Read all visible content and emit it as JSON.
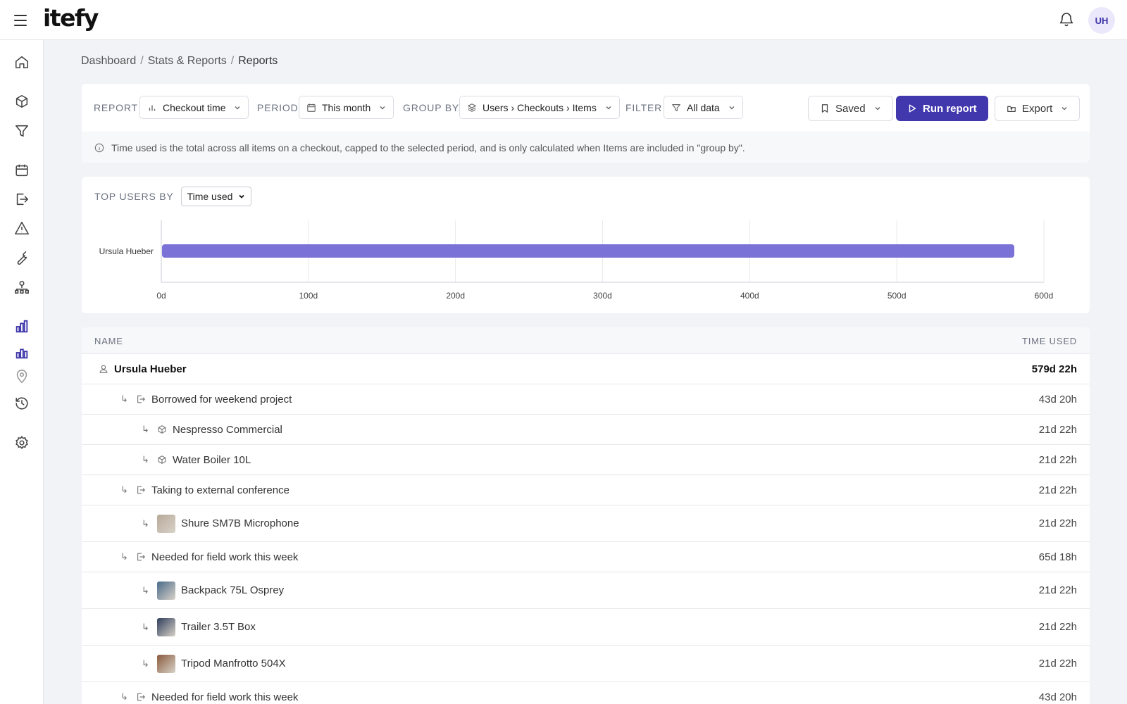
{
  "app": {
    "logo": "itefy",
    "user_initials": "UH"
  },
  "sidebar": {
    "items": [
      {
        "icon": "home-icon"
      },
      {
        "icon": "box-icon"
      },
      {
        "icon": "filter-icon"
      },
      {
        "icon": "calendar-icon"
      },
      {
        "icon": "checkout-icon"
      },
      {
        "icon": "alert-icon"
      },
      {
        "icon": "wrench-icon"
      },
      {
        "icon": "org-chart-icon"
      },
      {
        "icon": "bar-chart-icon"
      },
      {
        "icon": "bar-chart-alt-icon"
      },
      {
        "icon": "location-pin-icon"
      },
      {
        "icon": "history-icon"
      },
      {
        "icon": "gear-icon"
      }
    ]
  },
  "breadcrumb": {
    "items": [
      "Dashboard",
      "Stats & Reports",
      "Reports"
    ]
  },
  "toolbar": {
    "report_label": "REPORT",
    "report_value": "Checkout time",
    "period_label": "PERIOD",
    "period_value": "This month",
    "group_label": "GROUP BY",
    "group_value": "Users › Checkouts › Items",
    "filter_label": "FILTER",
    "filter_value": "All data",
    "saved_label": "Saved",
    "run_label": "Run report",
    "export_label": "Export",
    "accent": "#4238ae"
  },
  "info": {
    "text": "Time used is the total across all items on a checkout, capped to the selected period, and is only calculated when Items are included in \"group by\"."
  },
  "top_users": {
    "label": "TOP USERS BY",
    "selected": "Time used"
  },
  "chart_data": {
    "type": "bar",
    "orientation": "horizontal",
    "categories": [
      "Ursula Hueber"
    ],
    "values": [
      579.9
    ],
    "xlim": [
      0,
      600
    ],
    "ticks": [
      "0d",
      "100d",
      "200d",
      "300d",
      "400d",
      "500d",
      "600d"
    ],
    "tick_values": [
      0,
      100,
      200,
      300,
      400,
      500,
      600
    ],
    "grid": true,
    "bar_color": "#7b72d8"
  },
  "table": {
    "col_name": "NAME",
    "col_time": "TIME USED",
    "rows": [
      {
        "level": 0,
        "kind": "user",
        "name": "Ursula Hueber",
        "time": "579d 22h"
      },
      {
        "level": 1,
        "kind": "checkout",
        "name": "Borrowed for weekend project",
        "time": "43d 20h"
      },
      {
        "level": 2,
        "kind": "item",
        "name": "Nespresso Commercial",
        "time": "21d 22h"
      },
      {
        "level": 2,
        "kind": "item",
        "name": "Water Boiler 10L",
        "time": "21d 22h"
      },
      {
        "level": 1,
        "kind": "checkout",
        "name": "Taking to external conference",
        "time": "21d 22h"
      },
      {
        "level": 2,
        "kind": "photo",
        "name": "Shure SM7B Microphone",
        "time": "21d 22h",
        "thumb": "#b7a999"
      },
      {
        "level": 1,
        "kind": "checkout",
        "name": "Needed for field work this week",
        "time": "65d 18h"
      },
      {
        "level": 2,
        "kind": "photo",
        "name": "Backpack 75L Osprey",
        "time": "21d 22h",
        "thumb": "#4a6a8a"
      },
      {
        "level": 2,
        "kind": "photo",
        "name": "Trailer 3.5T Box",
        "time": "21d 22h",
        "thumb": "#2f3e5c"
      },
      {
        "level": 2,
        "kind": "photo",
        "name": "Tripod Manfrotto 504X",
        "time": "21d 22h",
        "thumb": "#8a5a3c"
      },
      {
        "level": 1,
        "kind": "checkout",
        "name": "Needed for field work this week",
        "time": "43d 20h"
      }
    ]
  }
}
